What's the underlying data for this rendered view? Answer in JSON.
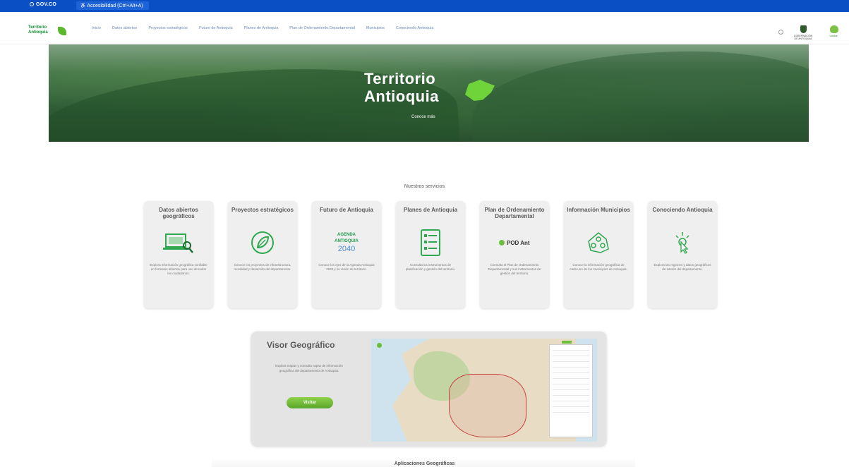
{
  "topbar": {
    "gov_label": "GOV.CO",
    "accessibility_label": "Accesibilidad (Ctrl+Alt+A)"
  },
  "brand": {
    "line1": "Territorio",
    "line2": "Antioquia"
  },
  "nav": {
    "items": [
      "Inicio",
      "Datos abiertos",
      "Proyectos estratégicos",
      "Futuro de Antioquia",
      "Planes de Antioquia",
      "Plan de Ordenamiento Departamental",
      "Municipios",
      "Conociendo Antioquia"
    ]
  },
  "header_logos": {
    "gob_text": "GOBERNACIÓN DE ANTIOQUIA",
    "unidos_text": "Unidos"
  },
  "hero": {
    "title_line1": "Territorio",
    "title_line2": "Antioquia",
    "subtitle": "Conoce más"
  },
  "services": {
    "title": "Nuestros servicios",
    "cards": [
      {
        "title": "Datos abiertos geográficos",
        "desc": "Explora información geográfica confiable en formatos abiertos para uso de todos los ciudadanos.",
        "icon": "laptop-search-icon"
      },
      {
        "title": "Proyectos estratégicos",
        "desc": "Conoce los proyectos de infraestructura, movilidad y desarrollo del departamento.",
        "icon": "leaf-circle-icon"
      },
      {
        "title": "Futuro de Antioquia",
        "desc": "Conoce los ejes de la Agenda Antioquia 2040 y su visión de territorio.",
        "icon": "agenda-2040-icon",
        "badge_line1": "AGENDA",
        "badge_line2": "ANTIOQUIA",
        "badge_line3": "2040"
      },
      {
        "title": "Planes de Antioquia",
        "desc": "Consulta los instrumentos de planificación y gestión del territorio.",
        "icon": "checklist-icon"
      },
      {
        "title": "Plan de Ordenamiento Departamental",
        "desc": "Consulta el Plan de Ordenamiento Departamental y sus instrumentos de gestión del territorio.",
        "icon": "pod-logo-icon",
        "badge": "POD Ant"
      },
      {
        "title": "Información Municipios",
        "desc": "Conoce la información geográfica de cada uno de los municipios de Antioquia.",
        "icon": "municipalities-map-icon"
      },
      {
        "title": "Conociendo Antioquia",
        "desc": "Explora las regiones y datos geográficos de interés del departamento.",
        "icon": "pointer-click-icon"
      }
    ]
  },
  "visor": {
    "title": "Visor Geográfico",
    "desc": "Explora mapas y consulta capas de información geográfica del departamento de Antioquia.",
    "button": "Visitar"
  },
  "next_section": {
    "title": "Aplicaciones Geográficas"
  },
  "colors": {
    "topbar": "#0b4fc4",
    "brand_green": "#128d33",
    "accent_green": "#6cbf3a",
    "card_bg": "#efefef"
  }
}
